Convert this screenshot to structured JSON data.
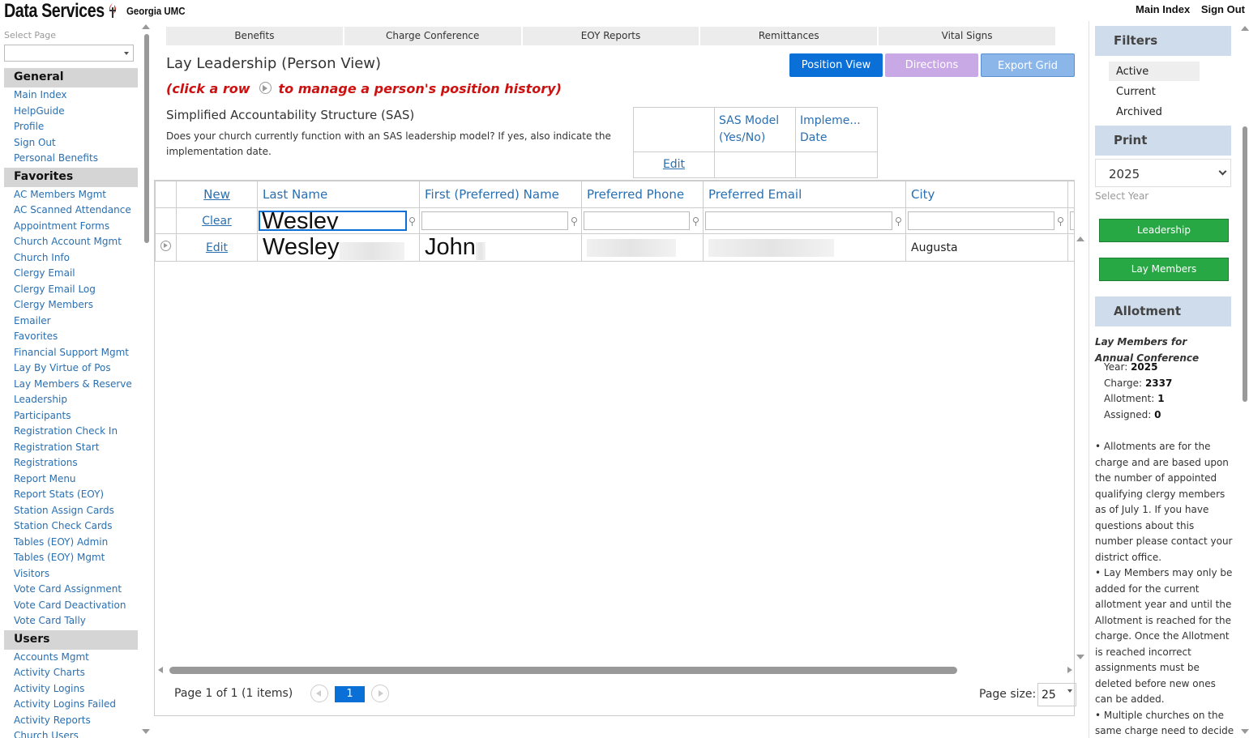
{
  "header": {
    "brand": "Data Services",
    "org": "Georgia UMC",
    "nav": [
      "Main Index",
      "Sign Out"
    ]
  },
  "sidebar": {
    "select_label": "Select Page",
    "sections": [
      {
        "title": "General",
        "items": [
          "Main Index",
          "HelpGuide",
          "Profile",
          "Sign Out",
          "Personal Benefits"
        ]
      },
      {
        "title": "Favorites",
        "items": [
          "AC Members Mgmt",
          "AC Scanned Attendance",
          "Appointment Forms",
          "Church Account Mgmt",
          "Church Info",
          "Clergy Email",
          "Clergy Email Log",
          "Clergy Members",
          "Emailer",
          "Favorites",
          "Financial Support Mgmt",
          "Lay By Virtue of Pos",
          "Lay Members & Reserve",
          "Leadership",
          "Participants",
          "Registration Check In",
          "Registration Start",
          "Registrations",
          "Report Menu",
          "Report Stats (EOY)",
          "Station Assign Cards",
          "Station Check Cards",
          "Tables (EOY) Admin",
          "Tables (EOY) Mgmt",
          "Visitors",
          "Vote Card Assignment",
          "Vote Card Deactivation",
          "Vote Card Tally"
        ]
      },
      {
        "title": "Users",
        "items": [
          "Accounts Mgmt",
          "Activity Charts",
          "Activity Logins",
          "Activity Logins Failed",
          "Activity Reports",
          "Church Users"
        ]
      }
    ]
  },
  "tabs": [
    "Benefits",
    "Charge Conference",
    "EOY Reports",
    "Remittances",
    "Vital Signs"
  ],
  "page": {
    "title": "Lay Leadership (Person View)",
    "hint_pre": "(click a row",
    "hint_post": "to manage a person's position history)",
    "buttons": {
      "position_view": "Position View",
      "directions": "Directions",
      "export_grid": "Export Grid"
    }
  },
  "sas": {
    "title": "Simplified Accountability Structure (SAS)",
    "description": "Does your church currently function with an SAS leadership model? If yes, also indicate the implementation date.",
    "col_model": "SAS Model (Yes/No)",
    "col_date": "Impleme... Date",
    "edit": "Edit"
  },
  "grid": {
    "new_label": "New",
    "clear_label": "Clear",
    "columns": [
      "Last Name",
      "First (Preferred) Name",
      "Preferred Phone",
      "Preferred Email",
      "City"
    ],
    "filter_last_name": "Wesley",
    "rows": [
      {
        "action": "Edit",
        "last_name": "Wesley",
        "first_name": "John",
        "city": "Augusta"
      }
    ],
    "pager_info": "Page 1 of 1 (1 items)",
    "current_page": "1",
    "page_size_label": "Page size:",
    "page_size": "25"
  },
  "right": {
    "filters_title": "Filters",
    "filters": [
      "Active",
      "Current",
      "Archived"
    ],
    "active_filter": "Active",
    "print_title": "Print",
    "year": "2025",
    "select_year_label": "Select Year",
    "print_buttons": [
      "Leadership",
      "Lay Members"
    ],
    "allotment_title": "Allotment",
    "allotment_heading_1": "Lay Members for",
    "allotment_heading_2": "Annual Conference",
    "stats": [
      {
        "label": "Year:",
        "value": "2025"
      },
      {
        "label": "Charge:",
        "value": "2337"
      },
      {
        "label": "Allotment:",
        "value": "1"
      },
      {
        "label": "Assigned:",
        "value": "0"
      }
    ],
    "notes": [
      "• Allotments are for the charge and are based upon the number of appointed qualifying clergy members as of July 1. If you have questions about this number please contact your district office.",
      "• Lay Members may only be added for the current allotment year and until the Allotment is reached for the charge. Once the Allotment is reached incorrect assignments must be deleted before new ones can be added.",
      "• Multiple churches on the same charge need to decide"
    ]
  },
  "colors": {
    "link": "#2a6fb0",
    "primary_button": "#0b6fd8",
    "directions_button": "#c9a8e6",
    "export_button": "#8ab6ea",
    "green_button": "#28a745",
    "hint_red": "#cc1111",
    "section_blue": "#cfdcec"
  }
}
